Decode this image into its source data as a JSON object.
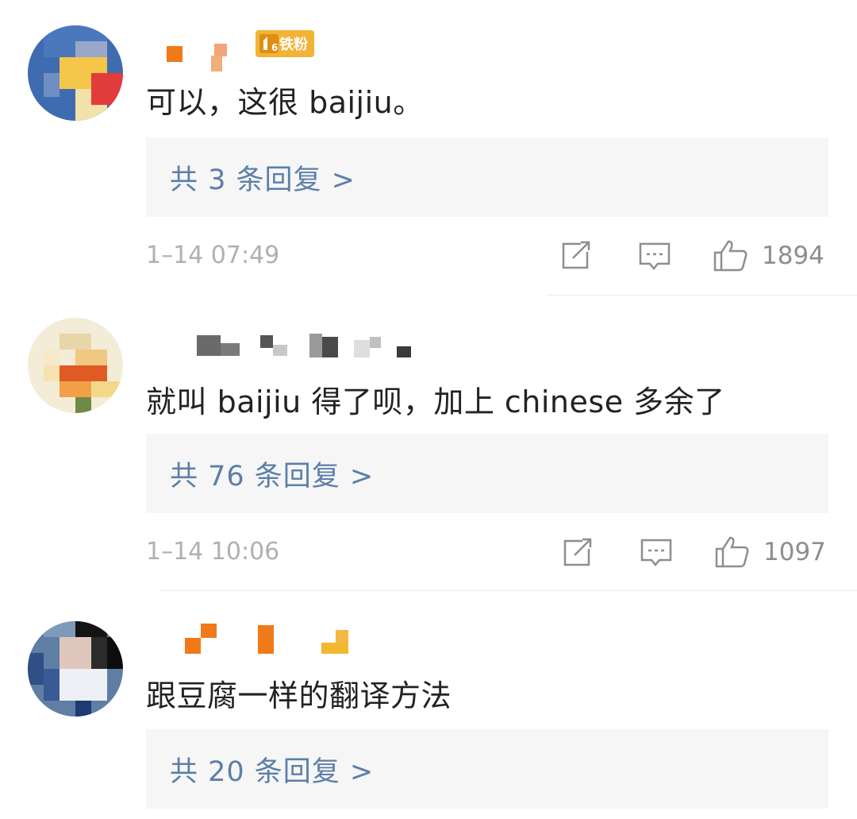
{
  "comments": [
    {
      "badge_label": "铁粉",
      "badge_level": "6",
      "text": "可以，这很 baijiu。",
      "reply_label": "共 3 条回复 >",
      "time": "1–14 07:49",
      "likes": "1894"
    },
    {
      "text": "就叫 baijiu 得了呗，加上 chinese 多余了",
      "reply_label": "共 76 条回复 >",
      "time": "1–14 10:06",
      "likes": "1097"
    },
    {
      "text": "跟豆腐一样的翻译方法",
      "reply_label": "共 20 条回复 >"
    }
  ],
  "icons": {
    "share": "share-icon",
    "comment": "comment-icon",
    "like": "thumbs-up-icon",
    "badge": "fan-badge-icon"
  },
  "colors": {
    "reply_link": "#5b7fa8",
    "reply_bg": "#f6f6f6",
    "time": "#b0b0b0",
    "badge": "#f2b336"
  }
}
